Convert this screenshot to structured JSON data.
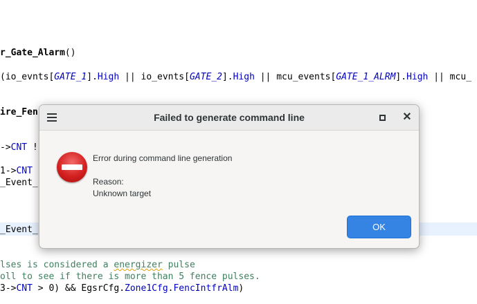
{
  "editor": {
    "line1": {
      "name": "r_Gate_Alarm",
      "paren": "()"
    },
    "line2": {
      "t1": "(io_evnts[",
      "v1": "GATE_1",
      "t2": "].",
      "k1": "High",
      "t3": " || io_evnts[",
      "v2": "GATE_2",
      "t4": "].",
      "k2": "High",
      "t5": " || mcu_events[",
      "v3": "GATE_1_ALRM",
      "t6": "].",
      "k3": "High",
      "t7": " || mcu_"
    },
    "line3": {
      "text": "ire_Fen"
    },
    "line4": {
      "t1": "->",
      "k1": "CNT",
      "t2": " !"
    },
    "line5": {
      "t1": "1->",
      "k1": "CNT",
      "t2": " "
    },
    "line6": {
      "text": "_Event_"
    },
    "line7": {
      "text": "_Event_"
    },
    "line8": {
      "c1": "lses is considered a ",
      "c2": "energizer",
      "c3": " pulse"
    },
    "line9": {
      "text": "oll to see if there is more than 5 fence pulses."
    },
    "line10": {
      "t1": "3->",
      "k1": "CNT",
      "t2": " > 0) && EgsrCfg.",
      "k2": "Zone1Cfg",
      "t3": ".",
      "k3": "FencIntfrAlm",
      "t4": ")"
    }
  },
  "dialog": {
    "title": "Failed to generate command line",
    "message": "Error during command line generation",
    "reason_label": "Reason:",
    "reason_text": "Unknown target",
    "ok_label": "OK",
    "icons": {
      "menu": "hamburger-menu-icon",
      "maximize": "maximize-icon",
      "close": "close-icon",
      "error": "error-icon"
    },
    "close_glyph": "✕"
  },
  "colors": {
    "accent": "#3584e4",
    "keyword": "#0000c0",
    "comment": "#3f7f5f",
    "error_icon": "#d42020"
  }
}
